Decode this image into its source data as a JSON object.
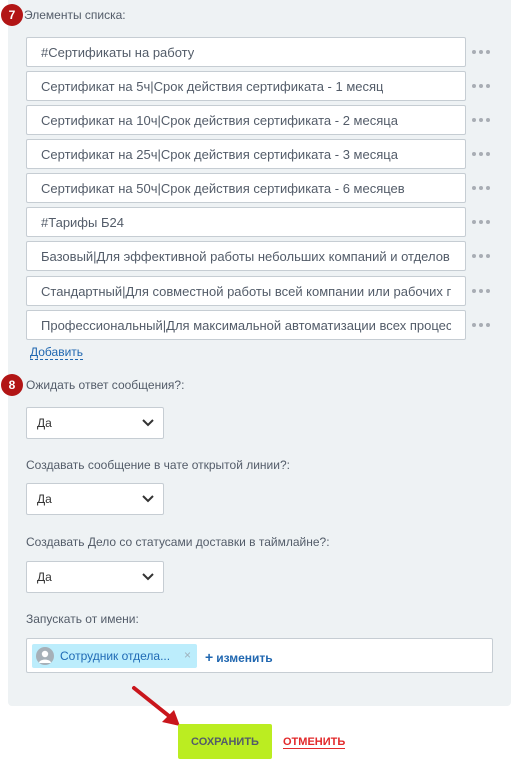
{
  "step_badges": {
    "seven": "7",
    "eight": "8"
  },
  "list_section": {
    "label": "Элементы списка:",
    "items": [
      "#Сертификаты на работу",
      "Сертификат на 5ч|Срок действия сертификата - 1 месяц",
      "Сертификат на 10ч|Срок действия сертификата - 2 месяца",
      "Сертификат на 25ч|Срок действия сертификата - 3 месяца",
      "Сертификат на 50ч|Срок действия сертификата - 6 месяцев",
      "#Тарифы Б24",
      "Базовый|Для эффективной работы небольших компаний и отделов пр",
      "Стандартный|Для совместной работы всей компании или рабочих гру",
      "Профессиональный|Для максимальной автоматизации всех процессов"
    ],
    "add_label": "Добавить"
  },
  "fields": {
    "wait_response": {
      "label": "Ожидать ответ сообщения?:",
      "value": "Да"
    },
    "create_message": {
      "label": "Создавать сообщение в чате открытой линии?:",
      "value": "Да"
    },
    "create_task": {
      "label": "Создавать Дело со статусами доставки в таймлайне?:",
      "value": "Да"
    },
    "run_as": {
      "label": "Запускать от имени:",
      "user": "Сотрудник отдела...",
      "remove": "×",
      "change_plus": "+",
      "change_label": "изменить"
    }
  },
  "actions": {
    "save": "СОХРАНИТЬ",
    "cancel": "ОТМЕНИТЬ"
  },
  "colors": {
    "panel_bg": "#eef2f4",
    "badge": "#b21515",
    "link": "#2067b0",
    "save": "#bbed21",
    "cancel": "#e2282a",
    "user_tag": "#bcedfc"
  }
}
